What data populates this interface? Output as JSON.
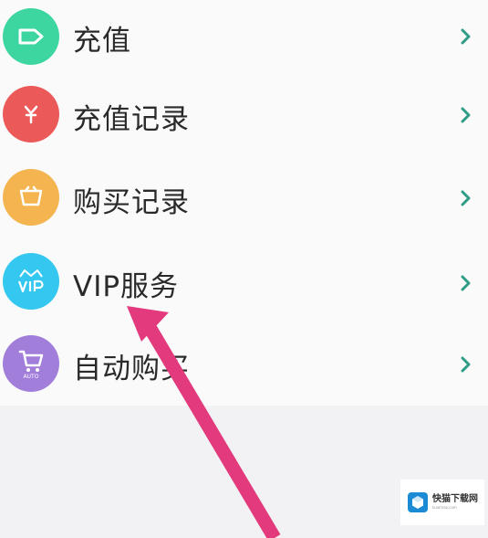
{
  "menu": {
    "items": [
      {
        "label": "充值",
        "icon": "recharge-icon",
        "color": "#3dd6a0"
      },
      {
        "label": "充值记录",
        "icon": "yuan-icon",
        "color": "#ec5959"
      },
      {
        "label": "购买记录",
        "icon": "basket-icon",
        "color": "#f4b44f"
      },
      {
        "label": "VIP服务",
        "icon": "vip-crown-icon",
        "color": "#34c7ef"
      },
      {
        "label": "自动购买",
        "icon": "cart-auto-icon",
        "color": "#a27edb",
        "icon_text": "AUTO"
      }
    ],
    "chevron_color": "#2f9c86"
  },
  "annotation": {
    "arrow_color": "#e23a7c"
  },
  "watermark": {
    "title": "快猫下载网",
    "subtitle": "kuaimao.com"
  }
}
